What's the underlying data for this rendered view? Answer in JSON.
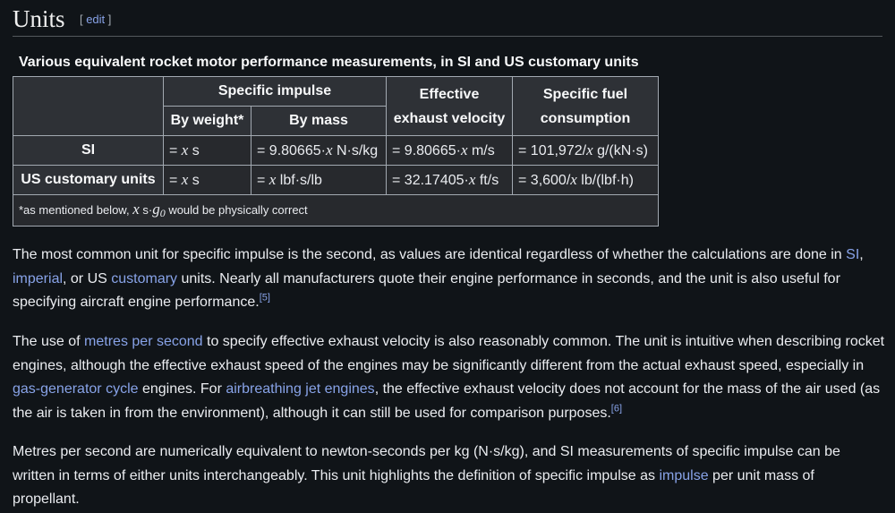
{
  "heading": {
    "title": "Units",
    "edit_label": "edit"
  },
  "table": {
    "caption": "Various equivalent rocket motor performance measurements, in SI and US customary units",
    "header": {
      "specific_impulse": "Specific impulse",
      "by_weight": "By weight*",
      "by_mass": "By mass",
      "eff_velocity_1": "Effective",
      "eff_velocity_2": "exhaust velocity",
      "sfc_1": "Specific fuel",
      "sfc_2": "consumption"
    },
    "rows": [
      {
        "label": "SI",
        "by_weight": {
          "pre": "= ",
          "var": "x",
          "post": " s"
        },
        "by_mass": {
          "pre": "= 9.80665·",
          "var": "x",
          "post": " N·s/kg"
        },
        "eff_velocity": {
          "pre": "= 9.80665·",
          "var": "x",
          "post": " m/s"
        },
        "sfc": {
          "pre": "= 101,972/",
          "var": "x",
          "post": " g/(kN·s)"
        }
      },
      {
        "label": "US customary units",
        "by_weight": {
          "pre": "= ",
          "var": "x",
          "post": " s"
        },
        "by_mass": {
          "pre": "= ",
          "var": "x",
          "post": " lbf·s/lb"
        },
        "eff_velocity": {
          "pre": "= 32.17405·",
          "var": "x",
          "post": " ft/s"
        },
        "sfc": {
          "pre": "= 3,600/",
          "var": "x",
          "post": " lb/(lbf·h)"
        }
      }
    ],
    "footnote": {
      "pre": "*as mentioned below, ",
      "var": "x",
      "mid": " s·",
      "g0": "g",
      "g0_sub": "0",
      "post": " would be physically correct"
    }
  },
  "paragraphs": {
    "p1": {
      "t1": "The most common unit for specific impulse is the second, as values are identical regardless of whether the calculations are done in ",
      "link_si": "SI",
      "t2": ", ",
      "link_imperial": "imperial",
      "t3": ", or US ",
      "link_customary": "customary",
      "t4": " units. Nearly all manufacturers quote their engine performance in seconds, and the unit is also useful for specifying aircraft engine performance.",
      "ref": "[5]"
    },
    "p2": {
      "t1": "The use of ",
      "link_mps": "metres per second",
      "t2": " to specify effective exhaust velocity is also reasonably common. The unit is intuitive when describing rocket engines, although the effective exhaust speed of the engines may be significantly different from the actual exhaust speed, especially in ",
      "link_gasgen": "gas-generator cycle",
      "t3": " engines. For ",
      "link_airbreathing": "airbreathing jet engines",
      "t4": ", the effective exhaust velocity does not account for the mass of the air used (as the air is taken in from the environment), although it can still be used for comparison purposes.",
      "ref": "[6]"
    },
    "p3": {
      "t1": "Metres per second are numerically equivalent to newton-seconds per kg (N·s/kg), and SI measurements of specific impulse can be written in terms of either units interchangeably. This unit highlights the definition of specific impulse as ",
      "link_impulse": "impulse",
      "t2": " per unit mass of propellant."
    }
  },
  "colors": {
    "background": "#101418",
    "text": "#eaecf0",
    "link": "#88a3e8",
    "table_bg": "#27292d",
    "border": "#a2a9b1"
  }
}
